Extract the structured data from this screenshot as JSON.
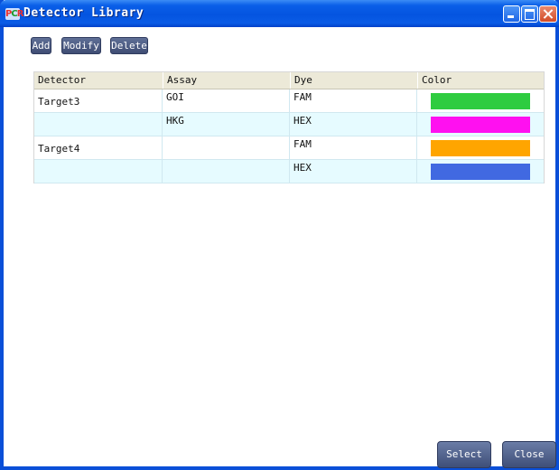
{
  "window": {
    "title": "Detector Library",
    "icon": "app-icon",
    "icon_text": [
      "P",
      "C",
      "R"
    ]
  },
  "toolbar": {
    "add_label": "Add",
    "modify_label": "Modify",
    "delete_label": "Delete"
  },
  "table": {
    "columns": [
      "Detector",
      "Assay",
      "Dye",
      "Color"
    ],
    "rows": [
      {
        "detector": "Target3",
        "assay": "GOI",
        "dye": "FAM",
        "color": "#2ecc40"
      },
      {
        "detector": "",
        "assay": "HKG",
        "dye": "HEX",
        "color": "#ff10f0"
      },
      {
        "detector": "Target4",
        "assay": "",
        "dye": "FAM",
        "color": "#ffa500"
      },
      {
        "detector": "",
        "assay": "",
        "dye": "HEX",
        "color": "#4169e1"
      }
    ]
  },
  "footer": {
    "select_label": "Select",
    "close_label": "Close"
  },
  "colors": {
    "titlebar": "#0454e0",
    "button": "#4a5a82",
    "header_bg": "#ece9d8",
    "row_alt_bg": "#e6fbff"
  }
}
